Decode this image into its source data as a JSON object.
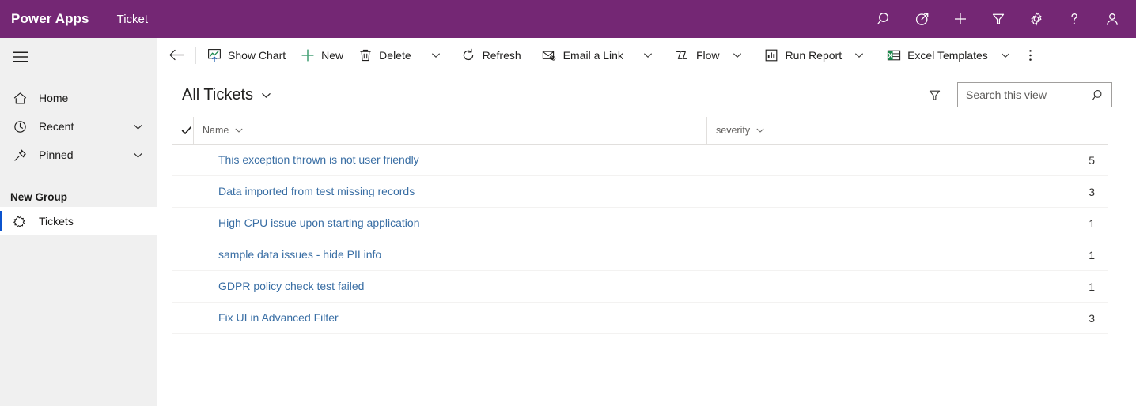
{
  "topbar": {
    "brand": "Power Apps",
    "app_name": "Ticket",
    "bg_color": "#742774",
    "icons": [
      {
        "name": "search-icon",
        "label": "Search"
      },
      {
        "name": "diagnostics-icon",
        "label": "Quick launch"
      },
      {
        "name": "plus-icon",
        "label": "New"
      },
      {
        "name": "filter-icon",
        "label": "Filter"
      },
      {
        "name": "gear-icon",
        "label": "Settings"
      },
      {
        "name": "help-icon",
        "label": "Help"
      },
      {
        "name": "account-icon",
        "label": "Account"
      }
    ]
  },
  "sidebar": {
    "hamburger_label": "Site Map",
    "items": [
      {
        "label": "Home",
        "icon": "home-icon",
        "chevron": false
      },
      {
        "label": "Recent",
        "icon": "clock-icon",
        "chevron": true
      },
      {
        "label": "Pinned",
        "icon": "pin-icon",
        "chevron": true
      }
    ],
    "group_title": "New Group",
    "group_items": [
      {
        "label": "Tickets",
        "icon": "entity-icon",
        "selected": true
      }
    ],
    "selected_accent": "#0b53ce",
    "bg_color": "#f0f0f0"
  },
  "commandbar": {
    "back_label": "Back",
    "buttons": [
      {
        "label": "Show Chart",
        "icon": "show-chart-icon",
        "caret": false
      },
      {
        "label": "New",
        "icon": "plus-green-icon",
        "caret": false
      },
      {
        "label": "Delete",
        "icon": "trash-icon",
        "caret": true
      },
      {
        "label": "Refresh",
        "icon": "refresh-icon",
        "caret": false
      },
      {
        "label": "Email a Link",
        "icon": "email-link-icon",
        "caret": true
      },
      {
        "label": "Flow",
        "icon": "flow-icon",
        "caret": true
      },
      {
        "label": "Run Report",
        "icon": "report-icon",
        "caret": true
      },
      {
        "label": "Excel Templates",
        "icon": "excel-icon",
        "caret": true
      }
    ],
    "overflow_label": "More commands"
  },
  "view": {
    "title": "All Tickets",
    "switcher_label": "Change view",
    "filter_label": "Show only my records",
    "search": {
      "placeholder": "Search this view",
      "value": "",
      "icon": "search-icon"
    }
  },
  "grid": {
    "select_all_label": "Select all rows",
    "columns": [
      {
        "label": "Name",
        "key": "name",
        "align": "left"
      },
      {
        "label": "severity",
        "key": "severity",
        "align": "right"
      }
    ],
    "rows": [
      {
        "name": "This exception thrown is not user friendly",
        "severity": "5"
      },
      {
        "name": "Data imported from test missing records",
        "severity": "3"
      },
      {
        "name": "High CPU issue upon starting application",
        "severity": "1"
      },
      {
        "name": "sample data issues - hide PII info",
        "severity": "1"
      },
      {
        "name": "GDPR policy check test failed",
        "severity": "1"
      },
      {
        "name": "Fix UI in Advanced Filter",
        "severity": "3"
      }
    ],
    "link_color": "#396ea4"
  }
}
